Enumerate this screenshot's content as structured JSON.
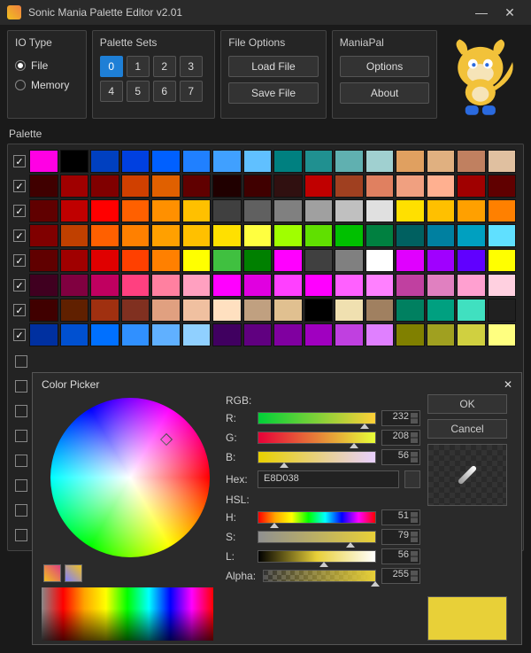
{
  "window": {
    "title": "Sonic Mania Palette Editor v2.01"
  },
  "io": {
    "title": "IO Type",
    "file": "File",
    "memory": "Memory",
    "selected": "file"
  },
  "sets": {
    "title": "Palette Sets",
    "labels": [
      "0",
      "1",
      "2",
      "3",
      "4",
      "5",
      "6",
      "7"
    ],
    "selected": 0
  },
  "fileopts": {
    "title": "File Options",
    "load": "Load File",
    "save": "Save File"
  },
  "maniapal": {
    "title": "ManiaPal",
    "options": "Options",
    "about": "About"
  },
  "palette_label": "Palette",
  "palette": {
    "rows": [
      {
        "c": true,
        "cols": [
          "#ff00e4",
          "#000000",
          "#0040c0",
          "#0040e0",
          "#0060ff",
          "#2080ff",
          "#40a0ff",
          "#60c0ff",
          "#008080",
          "#209090",
          "#60b0b0",
          "#a0d0d0",
          "#e0a060",
          "#e0b080",
          "#c08060",
          "#e0c0a0"
        ]
      },
      {
        "c": true,
        "cols": [
          "#400000",
          "#a00000",
          "#800000",
          "#d04000",
          "#e06000",
          "#600000",
          "#200000",
          "#400000",
          "#301010",
          "#c00000",
          "#a04020",
          "#e08060",
          "#f0a080",
          "#ffb090",
          "#a00000",
          "#600000"
        ]
      },
      {
        "c": true,
        "cols": [
          "#600000",
          "#c00000",
          "#ff0000",
          "#ff6000",
          "#ff9000",
          "#ffc000",
          "#404040",
          "#606060",
          "#808080",
          "#a0a0a0",
          "#c0c0c0",
          "#e0e0e0",
          "#ffe000",
          "#ffc000",
          "#ffa000",
          "#ff8000"
        ]
      },
      {
        "c": true,
        "cols": [
          "#800000",
          "#c04000",
          "#ff6000",
          "#ff8000",
          "#ffa000",
          "#ffc000",
          "#ffe000",
          "#ffff40",
          "#a0ff00",
          "#60e000",
          "#00c000",
          "#008040",
          "#006060",
          "#0080a0",
          "#00a0c0",
          "#60e0ff"
        ]
      },
      {
        "c": true,
        "cols": [
          "#600000",
          "#a00000",
          "#e00000",
          "#ff4000",
          "#ff8000",
          "#ffff00",
          "#40c040",
          "#008000",
          "#ff00ff",
          "#404040",
          "#808080",
          "#ffffff",
          "#e000ff",
          "#a000ff",
          "#6000ff",
          "#ffff00"
        ]
      },
      {
        "c": true,
        "cols": [
          "#400020",
          "#800040",
          "#c00060",
          "#ff4080",
          "#ff80a0",
          "#ffa0c0",
          "#ff00ff",
          "#e000e0",
          "#ff40ff",
          "#ff00ff",
          "#ff60ff",
          "#ff80ff",
          "#c040a0",
          "#e080c0",
          "#ffa0d0",
          "#ffd0e0"
        ]
      },
      {
        "c": true,
        "cols": [
          "#400000",
          "#602000",
          "#a03010",
          "#803020",
          "#e0a080",
          "#f0c0a0",
          "#ffe0c0",
          "#c0a080",
          "#e0c090",
          "#000000",
          "#f0e0b0",
          "#a08060",
          "#008060",
          "#00a080",
          "#40e0c0",
          "#202020"
        ]
      },
      {
        "c": true,
        "cols": [
          "#0030a0",
          "#0050d0",
          "#0070ff",
          "#3090ff",
          "#60b0ff",
          "#90d0ff",
          "#400060",
          "#600080",
          "#8000a0",
          "#a000c0",
          "#c040e0",
          "#e080ff",
          "#808000",
          "#a0a020",
          "#d0d040",
          "#ffff80"
        ]
      }
    ]
  },
  "picker": {
    "title": "Color Picker",
    "rgb": "RGB:",
    "r": "R:",
    "g": "G:",
    "b": "B:",
    "hex_label": "Hex:",
    "hsl": "HSL:",
    "h": "H:",
    "s": "S:",
    "l": "L:",
    "alpha": "Alpha:",
    "rv": "232",
    "gv": "208",
    "bv": "56",
    "hex": "E8D038",
    "hv": "51",
    "sv": "79",
    "lv": "56",
    "av": "255",
    "ok": "OK",
    "cancel": "Cancel",
    "preview": "#E8D038"
  }
}
